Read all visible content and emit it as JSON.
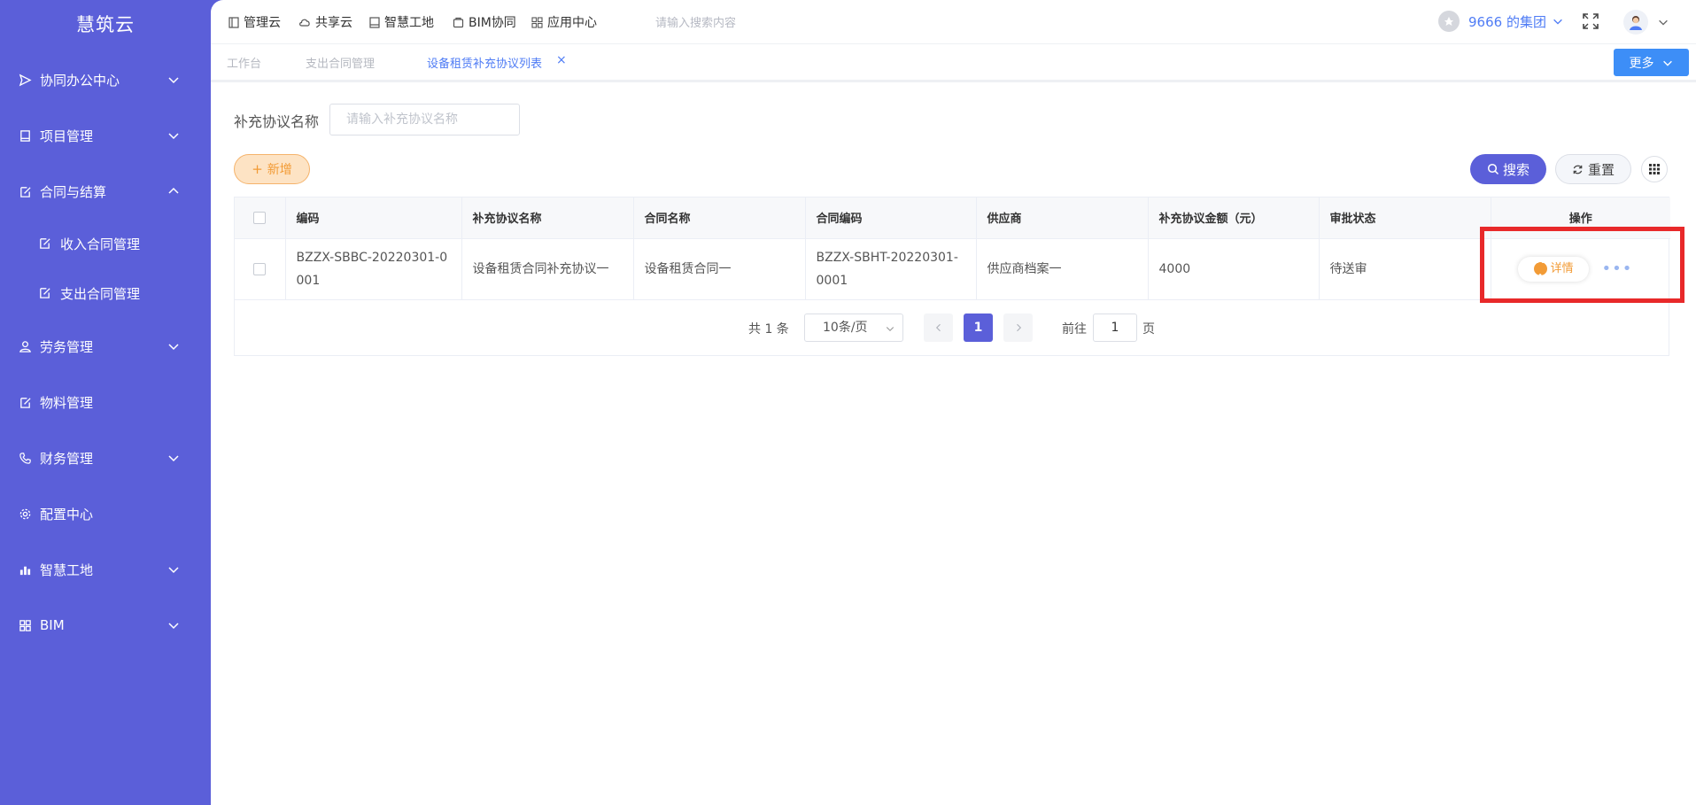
{
  "app": {
    "logo": "慧筑云"
  },
  "sidebar": {
    "items": [
      {
        "label": "协同办公中心",
        "icon": "send-icon",
        "expanded": false
      },
      {
        "label": "项目管理",
        "icon": "book-icon",
        "expanded": false
      },
      {
        "label": "合同与结算",
        "icon": "edit-icon",
        "expanded": true
      },
      {
        "label": "劳务管理",
        "icon": "user-icon",
        "expanded": false
      },
      {
        "label": "物料管理",
        "icon": "edit-icon",
        "expanded": false
      },
      {
        "label": "财务管理",
        "icon": "phone-icon",
        "expanded": false
      },
      {
        "label": "配置中心",
        "icon": "gear-icon",
        "expanded": false
      },
      {
        "label": "智慧工地",
        "icon": "chart-icon",
        "expanded": false
      },
      {
        "label": "BIM",
        "icon": "grid-icon",
        "expanded": false
      }
    ],
    "sub_items": [
      {
        "label": "收入合同管理",
        "icon": "edit-icon"
      },
      {
        "label": "支出合同管理",
        "icon": "edit-icon"
      }
    ]
  },
  "topnav": {
    "items": [
      {
        "label": "管理云",
        "icon": "doc-icon"
      },
      {
        "label": "共享云",
        "icon": "cloud-icon"
      },
      {
        "label": "智慧工地",
        "icon": "doc-icon"
      },
      {
        "label": "BIM协同",
        "icon": "cube-icon"
      },
      {
        "label": "应用中心",
        "icon": "grid-icon"
      }
    ],
    "search_placeholder": "请输入搜索内容",
    "group_name": "9666 的集团"
  },
  "tabs": {
    "items": [
      {
        "label": "工作台",
        "active": false
      },
      {
        "label": "支出合同管理",
        "active": false
      },
      {
        "label": "设备租赁补充协议列表",
        "active": true
      }
    ],
    "close_label": "×",
    "more_label": "更多"
  },
  "filter": {
    "label": "补充协议名称",
    "placeholder": "请输入补充协议名称",
    "value": ""
  },
  "actions": {
    "add_label": "新增",
    "search_label": "搜索",
    "reset_label": "重置"
  },
  "table": {
    "columns": [
      "编码",
      "补充协议名称",
      "合同名称",
      "合同编码",
      "供应商",
      "补充协议金额（元）",
      "审批状态",
      "操作"
    ],
    "rows": [
      {
        "code": "BZZX-SBBC-20220301-0001",
        "agreement_name": "设备租赁合同补充协议一",
        "contract_name": "设备租赁合同一",
        "contract_code": "BZZX-SBHT-20220301-0001",
        "supplier": "供应商档案一",
        "amount": "4000",
        "status": "待送审",
        "detail_label": "详情"
      }
    ]
  },
  "pager": {
    "total": "共 1 条",
    "page_size": "10条/页",
    "current": "1",
    "goto_label": "前往",
    "goto_value": "1",
    "page_suffix": "页"
  },
  "colors": {
    "sidebar": "#5b5fd9",
    "primary": "#5b5fd9",
    "link": "#4f7cf5",
    "accent_orange": "#f29b36",
    "highlight": "#e8292a"
  }
}
